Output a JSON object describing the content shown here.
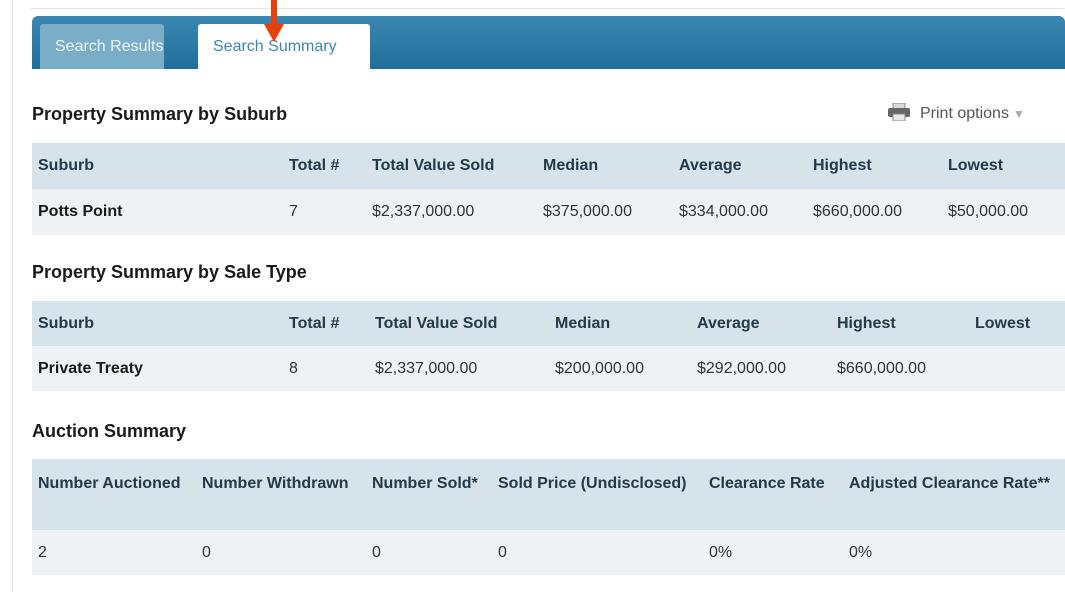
{
  "tabs": [
    {
      "label": "Search Results",
      "active": false
    },
    {
      "label": "Search Summary",
      "active": true
    }
  ],
  "print_label": "Print options",
  "colors": {
    "tab_bar": "#2b7aa6",
    "header_row": "#d7e3ea",
    "data_row": "#eef2f5",
    "arrow": "#e8400c"
  },
  "by_suburb": {
    "title": "Property Summary by Suburb",
    "headers": [
      "Suburb",
      "Total #",
      "Total Value Sold",
      "Median",
      "Average",
      "Highest",
      "Lowest"
    ],
    "row": [
      "Potts Point",
      "7",
      "$2,337,000.00",
      "$375,000.00",
      "$334,000.00",
      "$660,000.00",
      "$50,000.00"
    ]
  },
  "by_sale_type": {
    "title": "Property Summary by Sale Type",
    "headers": [
      "Suburb",
      "Total #",
      "Total Value Sold",
      "Median",
      "Average",
      "Highest",
      "Lowest"
    ],
    "row": [
      "Private Treaty",
      "8",
      "$2,337,000.00",
      "$200,000.00",
      "$292,000.00",
      "$660,000.00",
      ""
    ]
  },
  "auction": {
    "title": "Auction Summary",
    "headers": [
      "Number Auctioned",
      "Number Withdrawn",
      "Number Sold*",
      "Sold Price (Undisclosed)",
      "Clearance Rate",
      "Adjusted Clearance Rate**"
    ],
    "row": [
      "2",
      "0",
      "0",
      "0",
      "0%",
      "0%"
    ]
  }
}
